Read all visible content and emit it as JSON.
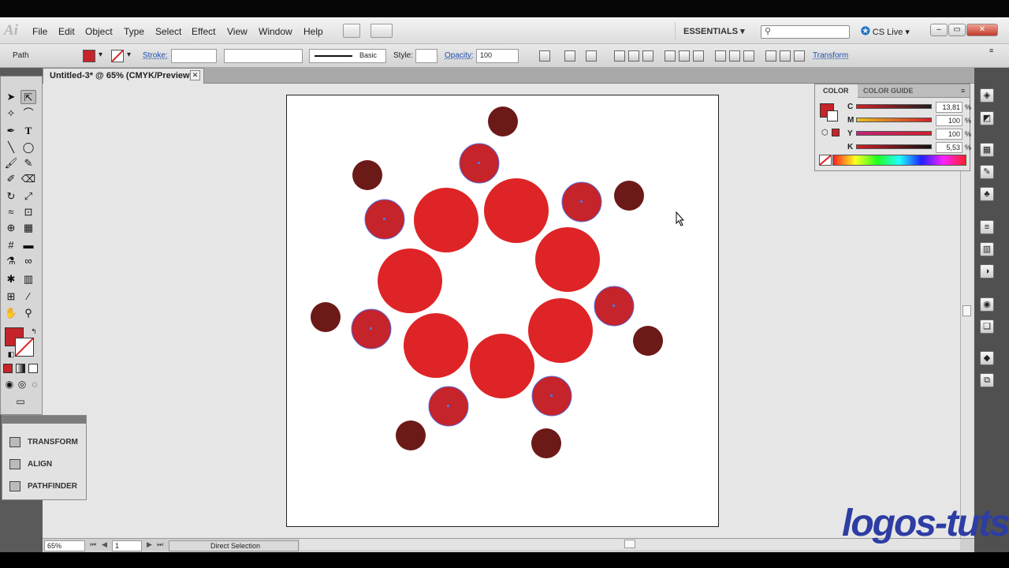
{
  "app": {
    "logo": "Ai",
    "menu": [
      "File",
      "Edit",
      "Object",
      "Type",
      "Select",
      "Effect",
      "View",
      "Window",
      "Help"
    ],
    "workspace": "ESSENTIALS",
    "cslive": "CS Live"
  },
  "control": {
    "selection_type": "Path",
    "stroke_label": "Stroke:",
    "brush_label": "Basic",
    "style_label": "Style:",
    "opacity_label": "Opacity:",
    "opacity_value": "100",
    "transform_link": "Transform"
  },
  "document": {
    "tab_title": "Untitled-3* @ 65% (CMYK/Preview)",
    "close_glyph": "✕"
  },
  "color_panel": {
    "tab_color": "COLOR",
    "tab_guide": "COLOR GUIDE",
    "c_label": "C",
    "c_value": "13,81",
    "m_label": "M",
    "m_value": "100",
    "y_label": "Y",
    "y_value": "100",
    "k_label": "K",
    "k_value": "5,53",
    "unit": "%"
  },
  "mini_panels": {
    "transform": "TRANSFORM",
    "align": "ALIGN",
    "pathfinder": "PATHFINDER"
  },
  "status": {
    "zoom": "65%",
    "artboard_number": "1",
    "tool_status": "Direct Selection"
  },
  "watermark": "logos-tuts",
  "colors": {
    "fill_red": "#de2426",
    "dark_red": "#6b1a18",
    "selected_fill": "#c4242a",
    "selection_handle": "#5b6fe0"
  }
}
